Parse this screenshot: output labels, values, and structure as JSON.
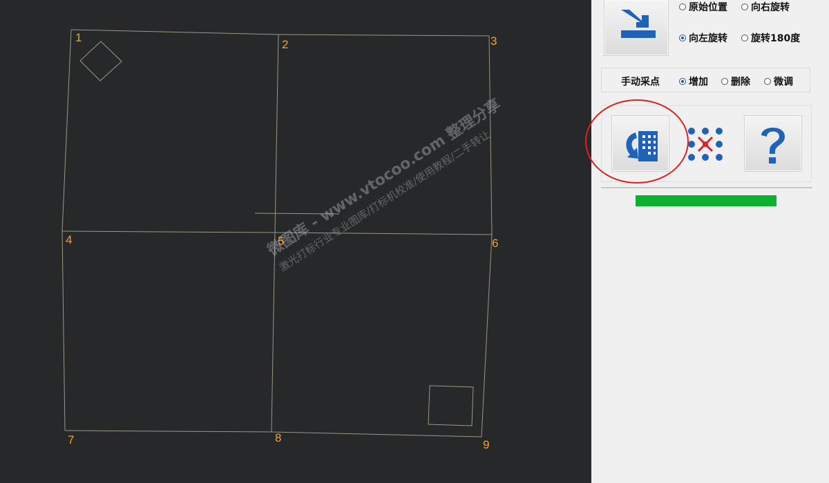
{
  "grid_points": [
    {
      "label": "1"
    },
    {
      "label": "2"
    },
    {
      "label": "3"
    },
    {
      "label": "4"
    },
    {
      "label": "5"
    },
    {
      "label": "6"
    },
    {
      "label": "7"
    },
    {
      "label": "8"
    },
    {
      "label": "9"
    }
  ],
  "watermark": {
    "line1": "微图库 - www.vtocoo.com 整理分享",
    "line2": "激光打标行业专业图库/打标机校准/使用教程/二手转让"
  },
  "rotation": {
    "options": [
      "原始位置",
      "向右旋转",
      "向左旋转",
      "旋转180度"
    ],
    "selected": "向左旋转"
  },
  "manual_sampling": {
    "label": "手动采点",
    "options": [
      "增加",
      "删除",
      "微调"
    ],
    "selected": "增加"
  },
  "toolbar_icons": [
    "apply-transform-icon",
    "rotate-grid-icon",
    "grid-points-clear-icon",
    "help-icon"
  ],
  "progress": {
    "fraction": 1.0
  },
  "colors": {
    "canvas_bg": "#26282a",
    "point_label": "#f5a524",
    "accent_blue": "#1f63b8",
    "progress_green": "#0eb02e",
    "highlight_red": "#e02020"
  }
}
